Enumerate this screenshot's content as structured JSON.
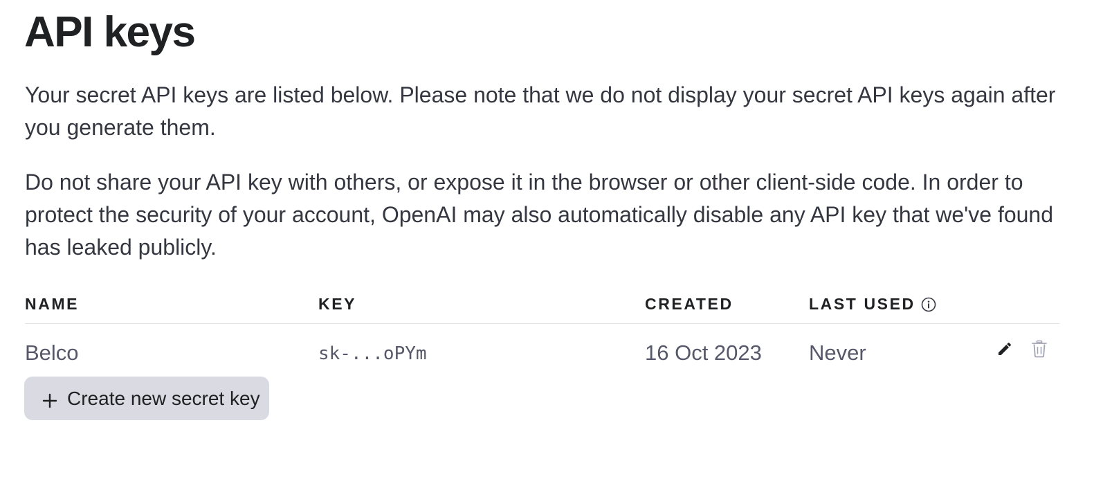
{
  "page": {
    "title": "API keys",
    "paragraphs": [
      "Your secret API keys are listed below. Please note that we do not display your secret API keys again after you generate them.",
      "Do not share your API key with others, or expose it in the browser or other client-side code. In order to protect the security of your account, OpenAI may also automatically disable any API key that we've found has leaked publicly."
    ]
  },
  "table": {
    "headers": {
      "name": "NAME",
      "key": "KEY",
      "created": "CREATED",
      "last_used": "LAST USED"
    },
    "rows": [
      {
        "name": "Belco",
        "key": "sk-...oPYm",
        "created": "16 Oct 2023",
        "last_used": "Never"
      }
    ]
  },
  "actions": {
    "create_label": "Create new secret key"
  },
  "icons": {
    "info": "info-icon",
    "edit": "pencil-icon",
    "delete": "trash-icon",
    "add": "plus-icon"
  },
  "colors": {
    "button_bg": "#dadae3",
    "text_primary": "#202123",
    "text_secondary": "#565869",
    "divider": "#e5e5e5"
  }
}
